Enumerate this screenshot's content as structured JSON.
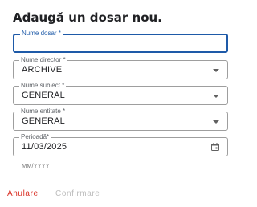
{
  "dialog": {
    "title": "Adaugă un dosar nou."
  },
  "fields": {
    "folder_name": {
      "label": "Nume dosar *",
      "value": ""
    },
    "director_name": {
      "label": "Nume director *",
      "value": "ARCHIVE"
    },
    "subject_name": {
      "label": "Nume subiect *",
      "value": "GENERAL"
    },
    "entity_name": {
      "label": "Nume entitate *",
      "value": "GENERAL"
    },
    "period": {
      "label": "Perioadă*",
      "value": "11/03/2025",
      "helper": "MM/YYYY"
    }
  },
  "actions": {
    "cancel_label": "Anulare",
    "confirm_label": "Confirmare"
  },
  "colors": {
    "accent": "#1e5aa8",
    "cancel": "#d93025",
    "disabled": "#bdbdbd"
  },
  "icons": {
    "dropdown": "chevron-down-icon",
    "calendar": "calendar-icon"
  }
}
